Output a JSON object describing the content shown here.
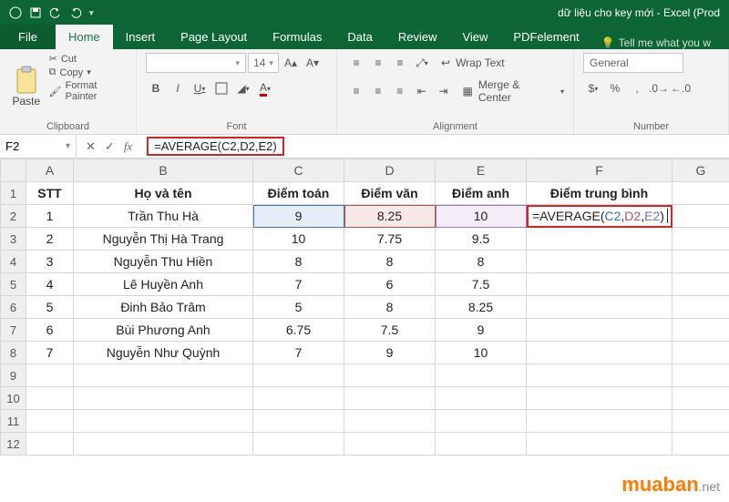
{
  "app": {
    "title": "dữ liệu cho key mới - Excel (Prod"
  },
  "tabs": {
    "file": "File",
    "home": "Home",
    "insert": "Insert",
    "page_layout": "Page Layout",
    "formulas": "Formulas",
    "data": "Data",
    "review": "Review",
    "view": "View",
    "pdfelement": "PDFelement",
    "tell_me": "Tell me what you w"
  },
  "ribbon": {
    "clipboard": {
      "paste": "Paste",
      "cut": "Cut",
      "copy": "Copy",
      "format_painter": "Format Painter",
      "label": "Clipboard"
    },
    "font": {
      "size": "14",
      "label": "Font"
    },
    "alignment": {
      "wrap": "Wrap Text",
      "merge": "Merge & Center",
      "label": "Alignment"
    },
    "number": {
      "format": "General",
      "label": "Number"
    }
  },
  "formula": {
    "name_box": "F2",
    "value": "=AVERAGE(C2,D2,E2)"
  },
  "columns": [
    "",
    "A",
    "B",
    "C",
    "D",
    "E",
    "F",
    "G"
  ],
  "col_widths": [
    "28px",
    "52px",
    "197px",
    "100px",
    "100px",
    "100px",
    "160px",
    "63px"
  ],
  "rows": [
    "1",
    "2",
    "3",
    "4",
    "5",
    "6",
    "7",
    "8",
    "9",
    "10",
    "11",
    "12"
  ],
  "headers": {
    "stt": "STT",
    "hovaten": "Họ và tên",
    "toan": "Điểm toán",
    "van": "Điểm văn",
    "anh": "Điểm anh",
    "tb": "Điểm trung bình"
  },
  "cell_formula": "=AVERAGE(C2,D2,E2)",
  "chart_data": {
    "type": "table",
    "columns": [
      "STT",
      "Họ và tên",
      "Điểm toán",
      "Điểm văn",
      "Điểm anh"
    ],
    "rows": [
      [
        1,
        "Trần Thu Hà",
        9,
        8.25,
        10
      ],
      [
        2,
        "Nguyễn Thị Hà Trang",
        10,
        7.75,
        9.5
      ],
      [
        3,
        "Nguyễn Thu Hiền",
        8,
        8,
        8
      ],
      [
        4,
        "Lê Huyền Anh",
        7,
        6,
        7.5
      ],
      [
        5,
        "Đinh Bảo Trâm",
        5,
        8,
        8.25
      ],
      [
        6,
        "Bùi Phương Anh",
        6.75,
        7.5,
        9
      ],
      [
        7,
        "Nguyễn Như Quỳnh",
        7,
        9,
        10
      ]
    ]
  },
  "watermark": {
    "brand": "muaban",
    "suffix": ".net"
  }
}
